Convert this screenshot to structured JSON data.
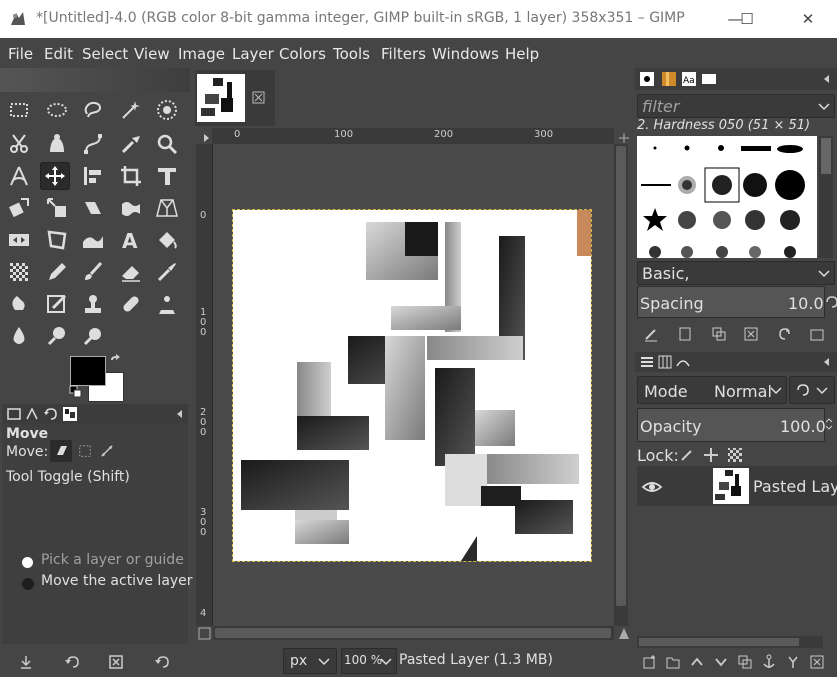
{
  "window": {
    "title": "*[Untitled]-4.0 (RGB color 8-bit gamma integer, GIMP built-in sRGB, 1 layer) 358x351 – GIMP",
    "minimize": "—",
    "maximize": "☐",
    "close": "✕"
  },
  "menu": [
    "File",
    "Edit",
    "Select",
    "View",
    "Image",
    "Layer",
    "Colors",
    "Tools",
    "Filters",
    "Windows",
    "Help"
  ],
  "tool_options": {
    "title": "Move",
    "move_label": "Move:",
    "toggle_label": "Tool Toggle  (Shift)",
    "option_pick": "Pick a layer or guide",
    "option_move": "Move the active layer"
  },
  "rulers": {
    "h_ticks": [
      "0",
      "100",
      "200",
      "300"
    ],
    "v_ticks": [
      "0",
      "1\n0\n0",
      "2\n0\n0",
      "3\n0\n0",
      "4"
    ]
  },
  "status": {
    "unit": "px",
    "zoom": "100 %",
    "layer_info": "Pasted Layer (1.3 MB)"
  },
  "brushes": {
    "filter_placeholder": "filter",
    "current_brush": "2. Hardness 050 (51 × 51)",
    "preset": "Basic,",
    "spacing_label": "Spacing",
    "spacing_value": "10.0"
  },
  "layers": {
    "mode_label": "Mode",
    "mode_value": "Normal",
    "opacity_label": "Opacity",
    "opacity_value": "100.0",
    "lock_label": "Lock:",
    "layer_name": "Pasted Layer"
  },
  "colors": {
    "accent": "#2b2b2b",
    "background": "#454545",
    "foreground_color": "#000000",
    "background_color": "#ffffff"
  }
}
